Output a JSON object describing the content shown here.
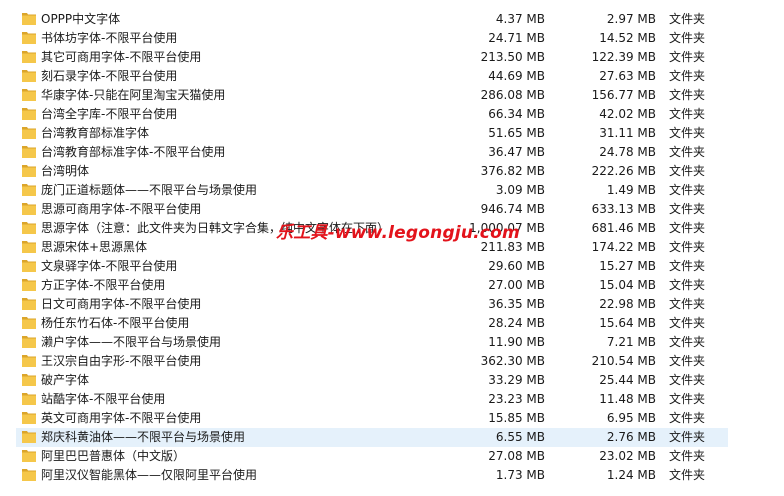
{
  "files": [
    {
      "name": "OPPP中文字体",
      "size": "4.37 MB",
      "compressed": "2.97 MB",
      "type": "文件夹"
    },
    {
      "name": "书体坊字体-不限平台使用",
      "size": "24.71 MB",
      "compressed": "14.52 MB",
      "type": "文件夹"
    },
    {
      "name": "其它可商用字体-不限平台使用",
      "size": "213.50 MB",
      "compressed": "122.39 MB",
      "type": "文件夹"
    },
    {
      "name": "刻石录字体-不限平台使用",
      "size": "44.69 MB",
      "compressed": "27.63 MB",
      "type": "文件夹"
    },
    {
      "name": "华康字体-只能在阿里淘宝天猫使用",
      "size": "286.08 MB",
      "compressed": "156.77 MB",
      "type": "文件夹"
    },
    {
      "name": "台湾全字库-不限平台使用",
      "size": "66.34 MB",
      "compressed": "42.02 MB",
      "type": "文件夹"
    },
    {
      "name": "台湾教育部标准字体",
      "size": "51.65 MB",
      "compressed": "31.11 MB",
      "type": "文件夹"
    },
    {
      "name": "台湾教育部标准字体-不限平台使用",
      "size": "36.47 MB",
      "compressed": "24.78 MB",
      "type": "文件夹"
    },
    {
      "name": "台湾明体",
      "size": "376.82 MB",
      "compressed": "222.26 MB",
      "type": "文件夹"
    },
    {
      "name": "庞门正道标题体——不限平台与场景使用",
      "size": "3.09 MB",
      "compressed": "1.49 MB",
      "type": "文件夹"
    },
    {
      "name": "思源可商用字体-不限平台使用",
      "size": "946.74 MB",
      "compressed": "633.13 MB",
      "type": "文件夹"
    },
    {
      "name": "思源字体（注意：此文件夹为日韩文字合集，纯中文字体在下面）",
      "size": "1,000.07 MB",
      "compressed": "681.46 MB",
      "type": "文件夹"
    },
    {
      "name": "思源宋体+思源黑体",
      "size": "211.83 MB",
      "compressed": "174.22 MB",
      "type": "文件夹"
    },
    {
      "name": "文泉驿字体-不限平台使用",
      "size": "29.60 MB",
      "compressed": "15.27 MB",
      "type": "文件夹"
    },
    {
      "name": "方正字体-不限平台使用",
      "size": "27.00 MB",
      "compressed": "15.04 MB",
      "type": "文件夹"
    },
    {
      "name": "日文可商用字体-不限平台使用",
      "size": "36.35 MB",
      "compressed": "22.98 MB",
      "type": "文件夹"
    },
    {
      "name": "杨任东竹石体-不限平台使用",
      "size": "28.24 MB",
      "compressed": "15.64 MB",
      "type": "文件夹"
    },
    {
      "name": "濑户字体——不限平台与场景使用",
      "size": "11.90 MB",
      "compressed": "7.21 MB",
      "type": "文件夹"
    },
    {
      "name": "王汉宗自由字形-不限平台使用",
      "size": "362.30 MB",
      "compressed": "210.54 MB",
      "type": "文件夹"
    },
    {
      "name": "破产字体",
      "size": "33.29 MB",
      "compressed": "25.44 MB",
      "type": "文件夹"
    },
    {
      "name": "站酷字体-不限平台使用",
      "size": "23.23 MB",
      "compressed": "11.48 MB",
      "type": "文件夹"
    },
    {
      "name": "英文可商用字体-不限平台使用",
      "size": "15.85 MB",
      "compressed": "6.95 MB",
      "type": "文件夹"
    },
    {
      "name": "郑庆科黄油体——不限平台与场景使用",
      "size": "6.55 MB",
      "compressed": "2.76 MB",
      "type": "文件夹",
      "selected": true
    },
    {
      "name": "阿里巴巴普惠体（中文版）",
      "size": "27.08 MB",
      "compressed": "23.02 MB",
      "type": "文件夹"
    },
    {
      "name": "阿里汉仪智能黑体——仅限阿里平台使用",
      "size": "1.73 MB",
      "compressed": "1.24 MB",
      "type": "文件夹"
    }
  ],
  "watermark": "乐工具-www.legongju.com",
  "colors": {
    "folder": "#f5c74a",
    "folder_dark": "#dba52b",
    "selected_row": "#e5f1fb",
    "watermark": "#e3131b"
  }
}
